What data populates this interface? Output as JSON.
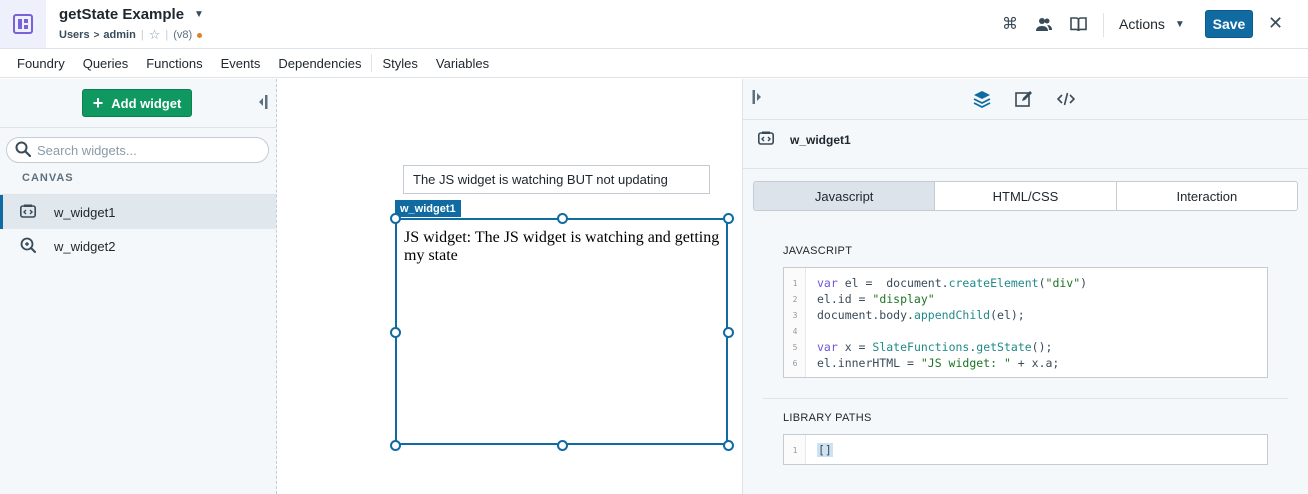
{
  "header": {
    "title": "getState Example",
    "breadcrumb_user": "Users",
    "breadcrumb_folder": "admin",
    "version": "(v8)",
    "actions_label": "Actions",
    "save_label": "Save"
  },
  "menu": {
    "items": [
      "Foundry",
      "Queries",
      "Functions",
      "Events",
      "Dependencies",
      "Styles",
      "Variables"
    ]
  },
  "sidebar": {
    "add_widget_label": "Add widget",
    "search_placeholder": "Search widgets...",
    "canvas_label": "CANVAS",
    "items": [
      {
        "label": "w_widget1",
        "icon": "code-widget-icon",
        "selected": true
      },
      {
        "label": "w_widget2",
        "icon": "search-widget-icon",
        "selected": false
      }
    ]
  },
  "canvas": {
    "text_widget_value": "The JS widget is watching BUT not updating",
    "selected_tag": "w_widget1",
    "selected_content": "JS widget: The JS widget is watching and getting my state"
  },
  "panel": {
    "widget_name": "w_widget1",
    "tabs": [
      "Javascript",
      "HTML/CSS",
      "Interaction"
    ],
    "active_tab": "Javascript",
    "javascript_label": "JAVASCRIPT",
    "library_label": "LIBRARY PATHS",
    "code_lines": [
      "var el =  document.createElement(\"div\")",
      "el.id = \"display\"",
      "document.body.appendChild(el);",
      "",
      "var x = SlateFunctions.getState();",
      "el.innerHTML = \"JS widget: \" + x.a;"
    ],
    "library_value": "[]"
  },
  "colors": {
    "primary": "#106ba3",
    "success": "#0f9960",
    "unsaved_dot": "#d9822b"
  }
}
